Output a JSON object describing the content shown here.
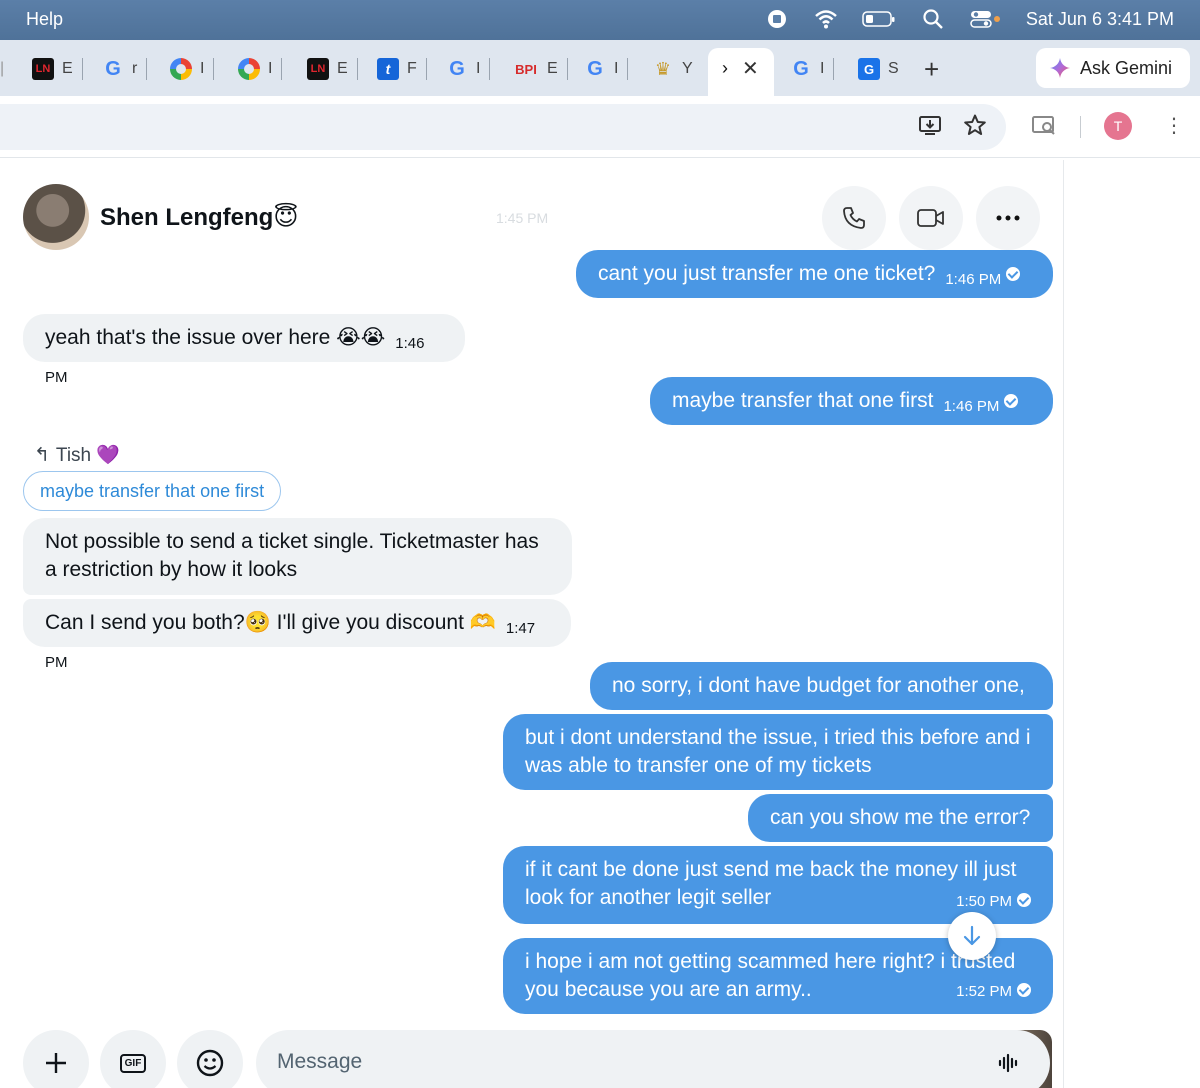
{
  "menubar": {
    "help_label": "Help",
    "date_time": "Sat Jun 6  3:41 PM"
  },
  "tabs": [
    {
      "icon": "ln-favicon",
      "text": "E"
    },
    {
      "icon": "google-favicon",
      "text": "r"
    },
    {
      "icon": "photos-favicon",
      "text": "I"
    },
    {
      "icon": "photos-favicon",
      "text": "I"
    },
    {
      "icon": "ln-favicon",
      "text": "E"
    },
    {
      "icon": "t-favicon",
      "text": "F"
    },
    {
      "icon": "google-favicon",
      "text": "I"
    },
    {
      "icon": "bpi-favicon",
      "text": "E"
    },
    {
      "icon": "google-favicon",
      "text": "I"
    },
    {
      "icon": "gold-favicon",
      "text": "Y"
    },
    {
      "icon": "x-favicon",
      "text": ""
    },
    {
      "icon": "google-favicon",
      "text": "I"
    },
    {
      "icon": "google-box-favicon",
      "text": "S"
    }
  ],
  "favicons": {
    "ln": "LN",
    "g": "G",
    "t": "t",
    "bpi": "BPI",
    "gbox": "G"
  },
  "gemini": {
    "label": "Ask Gemini"
  },
  "profile": {
    "initial": "T"
  },
  "chat": {
    "contact_name": "Shen Lengfeng😇",
    "ghost_time": "1:45 PM",
    "messages": [
      {
        "dir": "out",
        "text": "cant you just transfer me one ticket?",
        "time": "1:46 PM"
      },
      {
        "dir": "in",
        "text": "yeah that's the issue over here 😭😭",
        "time": "1:46 PM"
      },
      {
        "dir": "out",
        "text": "maybe transfer that one first",
        "time": "1:46 PM"
      },
      {
        "dir": "in",
        "text": "Not possible to send a ticket single. Ticketmaster has a restriction by how it looks",
        "time": ""
      },
      {
        "dir": "in",
        "text": "Can I send you both?🥺 I'll give you discount 🫶",
        "time": "1:47 PM"
      },
      {
        "dir": "out",
        "text": "no sorry, i dont have budget for another one,",
        "time": ""
      },
      {
        "dir": "out",
        "text": "but i dont understand the issue, i tried this before and i was able to transfer one of my tickets",
        "time": ""
      },
      {
        "dir": "out",
        "text": "can you show me the error?",
        "time": ""
      },
      {
        "dir": "out",
        "text": "if it cant be done just send me back the money ill just look for another legit seller",
        "time": "1:50 PM"
      },
      {
        "dir": "out",
        "text": "i hope i am not getting scammed here right? i trusted you because you are an army..",
        "time": "1:52 PM"
      }
    ],
    "reply": {
      "to": "Tish 💜",
      "quoted": "maybe transfer that one first"
    }
  },
  "composer": {
    "placeholder": "Message",
    "gif_label": "GIF"
  },
  "colors": {
    "outgoing": "#4a97e4",
    "incoming": "#eff2f4",
    "menubar": "#5b7fa8"
  }
}
